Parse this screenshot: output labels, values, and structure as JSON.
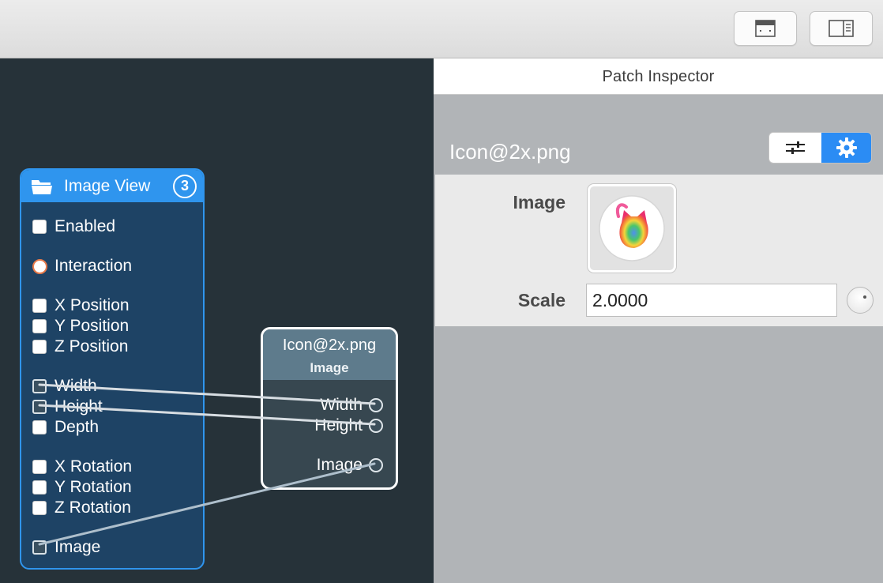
{
  "toolbar": {
    "buttons": [
      {
        "icon": "window-layout-icon"
      },
      {
        "icon": "sidebar-right-icon"
      }
    ]
  },
  "canvas": {
    "image_view_patch": {
      "title": "Image View",
      "badge": "3",
      "icon": "folder-icon",
      "ports": {
        "enabled": "Enabled",
        "interaction": "Interaction",
        "x_position": "X Position",
        "y_position": "Y Position",
        "z_position": "Z Position",
        "width": "Width",
        "height": "Height",
        "depth": "Depth",
        "x_rotation": "X Rotation",
        "y_rotation": "Y Rotation",
        "z_rotation": "Z Rotation",
        "image": "Image"
      }
    },
    "image_patch": {
      "title": "Icon@2x.png",
      "subtitle": "Image",
      "outputs": {
        "width": "Width",
        "height": "Height",
        "image": "Image"
      }
    }
  },
  "inspector": {
    "title": "Patch Inspector",
    "file_name": "Icon@2x.png",
    "segments": {
      "left_icon": "sliders-icon",
      "right_icon": "gear-icon",
      "selected": "gear"
    },
    "image_label": "Image",
    "scale_label": "Scale",
    "scale_value": "2.0000"
  },
  "colors": {
    "accent": "#2f95ee",
    "canvas_bg": "#263239",
    "patch_bg": "#1e4365",
    "interaction_port": "#e87a4a"
  }
}
